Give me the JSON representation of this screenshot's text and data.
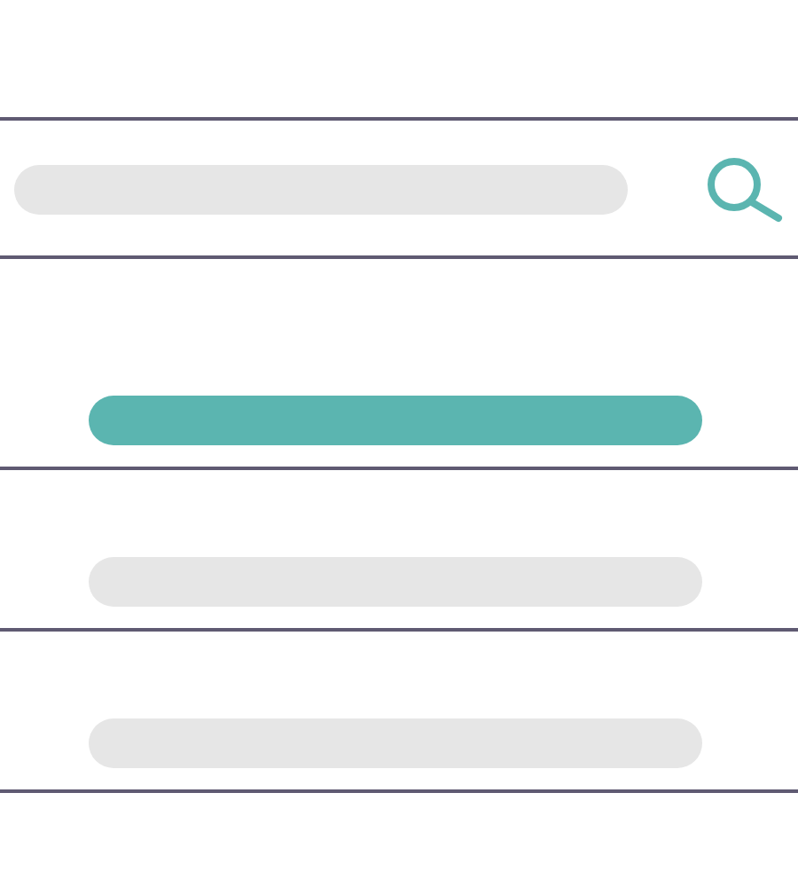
{
  "results": [
    {
      "selected": true
    },
    {
      "selected": false
    },
    {
      "selected": false
    }
  ]
}
